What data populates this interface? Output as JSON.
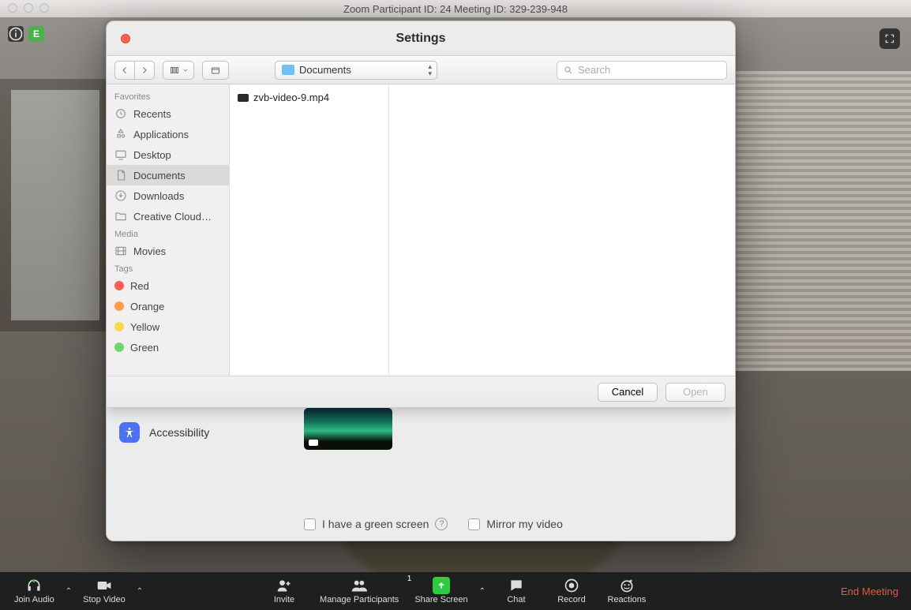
{
  "titlebar": "Zoom Participant ID: 24   Meeting ID: 329-239-948",
  "top_badge_letter": "E",
  "settings": {
    "title": "Settings",
    "accessibility_label": "Accessibility",
    "green_screen_label": "I have a green screen",
    "mirror_label": "Mirror my video"
  },
  "file_picker": {
    "location": "Documents",
    "search_placeholder": "Search",
    "sections": {
      "favorites_title": "Favorites",
      "media_title": "Media",
      "tags_title": "Tags"
    },
    "favorites": [
      {
        "label": "Recents",
        "icon": "clock"
      },
      {
        "label": "Applications",
        "icon": "apps"
      },
      {
        "label": "Desktop",
        "icon": "desktop"
      },
      {
        "label": "Documents",
        "icon": "doc",
        "selected": true
      },
      {
        "label": "Downloads",
        "icon": "download"
      },
      {
        "label": "Creative Cloud…",
        "icon": "folder"
      }
    ],
    "media": [
      {
        "label": "Movies",
        "icon": "movie"
      }
    ],
    "tags": [
      {
        "label": "Red",
        "color": "#ff5b52"
      },
      {
        "label": "Orange",
        "color": "#ff9e47"
      },
      {
        "label": "Yellow",
        "color": "#f8d84a"
      },
      {
        "label": "Green",
        "color": "#6ad86a"
      }
    ],
    "files": [
      {
        "name": "zvb-video-9.mp4"
      }
    ],
    "cancel_label": "Cancel",
    "open_label": "Open"
  },
  "toolbar": {
    "join_audio": "Join Audio",
    "stop_video": "Stop Video",
    "invite": "Invite",
    "manage": "Manage Participants",
    "participant_count": "1",
    "share": "Share Screen",
    "chat": "Chat",
    "record": "Record",
    "reactions": "Reactions",
    "end": "End Meeting"
  }
}
